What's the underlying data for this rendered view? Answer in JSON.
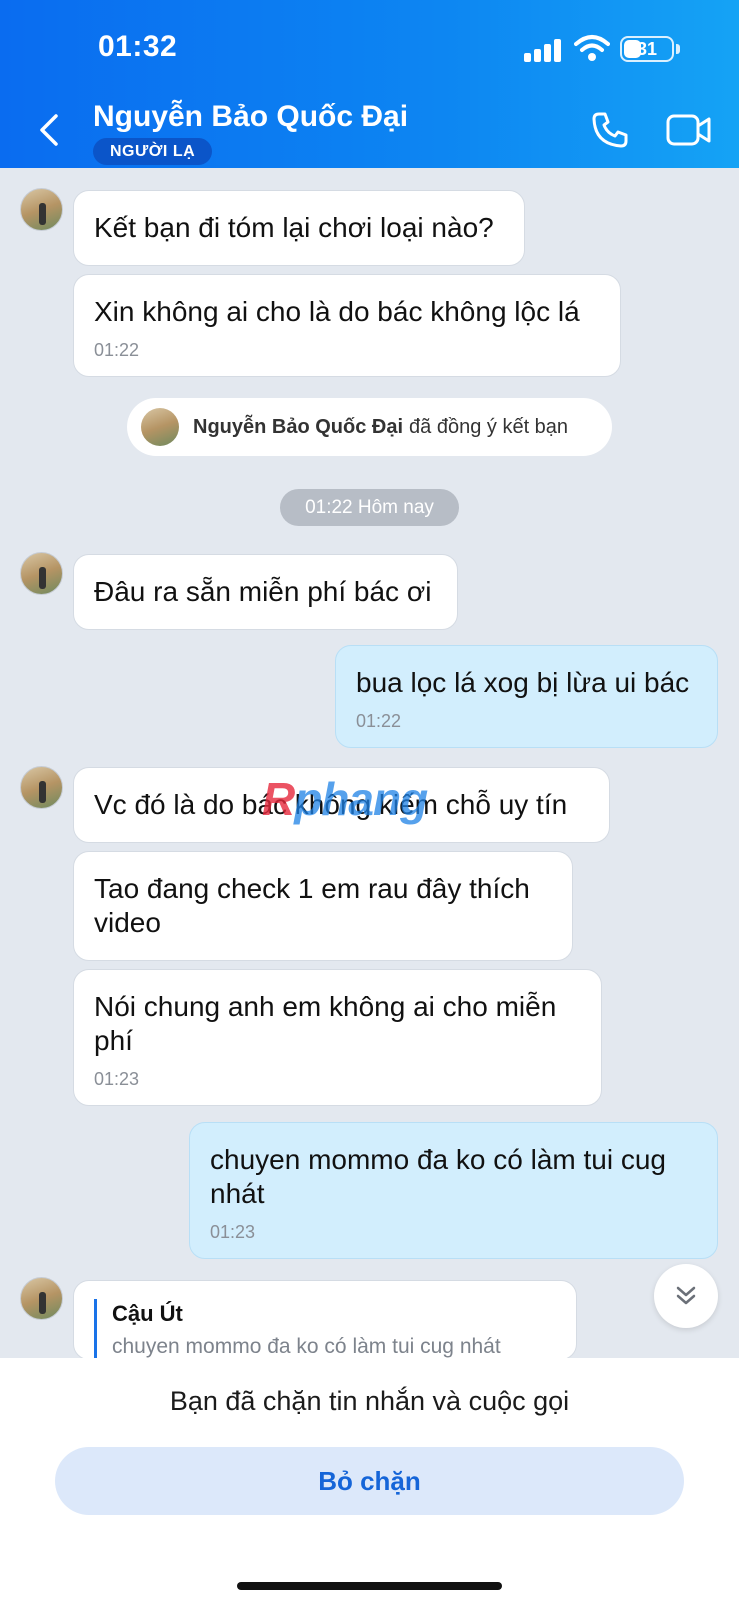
{
  "status_bar": {
    "time": "01:32",
    "battery": "31"
  },
  "header": {
    "contact_name": "Nguyễn Bảo Quốc Đại",
    "badge": "NGƯỜI LẠ"
  },
  "messages": [
    {
      "dir": "in",
      "text": "Kết bạn đi tóm lại chơi loại nào?"
    },
    {
      "dir": "in",
      "text": "Xin không ai cho là do bác không lộc lá",
      "time": "01:22"
    },
    {
      "dir": "in",
      "text": "Đâu ra sẵn miễn phí bác ơi"
    },
    {
      "dir": "out",
      "text": "bua lọc lá xog bị lừa ui bác",
      "time": "01:22"
    },
    {
      "dir": "in",
      "text": "Vc đó là do bác không kiếm chỗ uy tín"
    },
    {
      "dir": "in",
      "text": "Tao đang check 1 em rau đây thích video"
    },
    {
      "dir": "in",
      "text": "Nói chung anh em không ai cho miễn phí",
      "time": "01:23"
    },
    {
      "dir": "out",
      "text": "chuyen mommo đa ko có làm tui cug nhát",
      "time": "01:23"
    }
  ],
  "system_notice": {
    "name": "Nguyễn Bảo Quốc Đại",
    "action": "đã đồng ý kết bạn"
  },
  "date_separator": "01:22 Hôm nay",
  "reply_preview": {
    "name": "Cậu Út",
    "text": "chuyen mommo đa ko có làm tui cug nhát"
  },
  "watermark": {
    "r": "R",
    "rest": "phang"
  },
  "bottom": {
    "blocked_notice": "Bạn đã chặn tin nhắn và cuộc gọi",
    "unblock_label": "Bỏ chặn"
  },
  "colors": {
    "header_start": "#0a6cf0",
    "header_end": "#15a3f5",
    "outgoing_bubble": "#d2eefd",
    "accent": "#1565d8"
  }
}
